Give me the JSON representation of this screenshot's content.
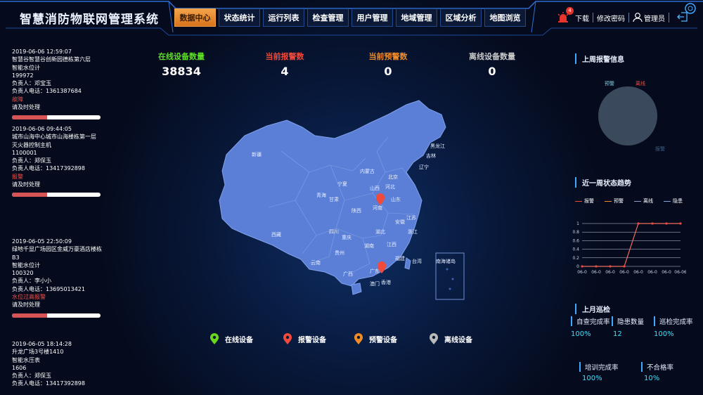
{
  "header": {
    "title": "智慧消防物联网管理系统",
    "nav": [
      "数据中心",
      "状态统计",
      "运行列表",
      "检查管理",
      "用户管理",
      "地域管理",
      "区域分析",
      "地图浏览"
    ],
    "active_index": 0,
    "bell_badge": "4",
    "download": "下载",
    "change_password": "修改密码",
    "user": "管理员"
  },
  "alarms": [
    {
      "time": "2019-06-06 12:59:07",
      "location": "智慧谷智慧谷创新园德栋第六层",
      "device": "智能水位计",
      "code": "199972",
      "person": "负责人：邓宝玉",
      "phone": "负责人电话：1361387684",
      "status": "故障",
      "action": "请及时处理",
      "progress": 0.4
    },
    {
      "time": "2019-06-06 09:44:05",
      "location": "城市山海中心城市山海楼栋第一层",
      "device": "灭火器控制主机",
      "code": "1100001",
      "person": "负责人：郑保玉",
      "phone": "负责人电话：13417392898",
      "status": "报警",
      "action": "请及时处理",
      "progress": 0.4
    },
    {
      "time": "2019-06-05 22:50:09",
      "location": "绿地千显广场园区金威万豪酒店楼栋B3",
      "device": "智能水位计",
      "code": "100320",
      "person": "负责人：李小小",
      "phone": "负责人电话：13695013421",
      "status": "水位过高报警",
      "action": "请及时处理",
      "progress": 0.4
    },
    {
      "time": "2019-06-05 18:14:28",
      "location": "升龙广场3号楼1410",
      "device": "智能水压表",
      "code": "1606",
      "person": "负责人：郑保玉",
      "phone": "负责人电话：13417392898",
      "status": "",
      "action": "",
      "progress": 0
    }
  ],
  "stats": [
    {
      "label": "在线设备数量",
      "value": "38834",
      "color": "#5de024"
    },
    {
      "label": "当前报警数",
      "value": "4",
      "color": "#ef4a3c"
    },
    {
      "label": "当前预警数",
      "value": "0",
      "color": "#f08b27"
    },
    {
      "label": "离线设备数量",
      "value": "0",
      "color": "#c9c9c9"
    }
  ],
  "map": {
    "provinces": [
      "新疆",
      "西藏",
      "青海",
      "甘肃",
      "宁夏",
      "内蒙古",
      "北京",
      "河北",
      "山西",
      "陕西",
      "河南",
      "山东",
      "四川",
      "重庆",
      "湖北",
      "安徽",
      "江苏",
      "浙江",
      "湖南",
      "江西",
      "贵州",
      "云南",
      "广西",
      "广东",
      "福建",
      "台湾",
      "辽宁",
      "吉林",
      "黑龙江",
      "香港",
      "澳门",
      "南海诸岛"
    ],
    "alert_pins": [
      "河南",
      "香港"
    ]
  },
  "legend": [
    {
      "label": "在线设备",
      "color": "#6ad61e"
    },
    {
      "label": "报警设备",
      "color": "#ef4a3c"
    },
    {
      "label": "预警设备",
      "color": "#f08b27"
    },
    {
      "label": "离线设备",
      "color": "#b9b9b9"
    }
  ],
  "right": {
    "last_week_title": "上周报警信息",
    "pie_labels": [
      "预警",
      "离线",
      "报警"
    ],
    "pie_colors": [
      "#7fc7d9",
      "#ef4a3c",
      "#3a5f8a"
    ],
    "trend_title": "近一周状态趋势",
    "trend_legend": [
      {
        "label": "报警",
        "color": "#ef4a3c"
      },
      {
        "label": "预警",
        "color": "#f08b27"
      },
      {
        "label": "离线",
        "color": "#8aa0c8"
      },
      {
        "label": "隐患",
        "color": "#7aa7e6"
      }
    ],
    "last_month_title": "上月巡检",
    "kpis": [
      {
        "label": "自查完成率",
        "value": "100%"
      },
      {
        "label": "隐患数量",
        "value": "12"
      },
      {
        "label": "巡检完成率",
        "value": "100%"
      },
      {
        "label": "培训完成率",
        "value": "100%"
      },
      {
        "label": "不合格率",
        "value": "10%"
      }
    ]
  },
  "chart_data": {
    "type": "line",
    "x": [
      "06-01",
      "06-02",
      "06-03",
      "06-04",
      "06-05",
      "06-06",
      "06-07",
      "06-08"
    ],
    "x_tick_labels": [
      "06-0",
      "06-0",
      "06-0",
      "06-0",
      "06-0",
      "06-0",
      "06-0",
      "06-06"
    ],
    "ylim": [
      0,
      1
    ],
    "y_ticks": [
      "0",
      "0.2",
      "0.4",
      "0.6",
      "0.8",
      "1"
    ],
    "series": [
      {
        "name": "报警",
        "values": [
          0,
          0,
          0,
          0,
          1,
          1,
          1,
          1
        ]
      }
    ],
    "grid": true
  }
}
